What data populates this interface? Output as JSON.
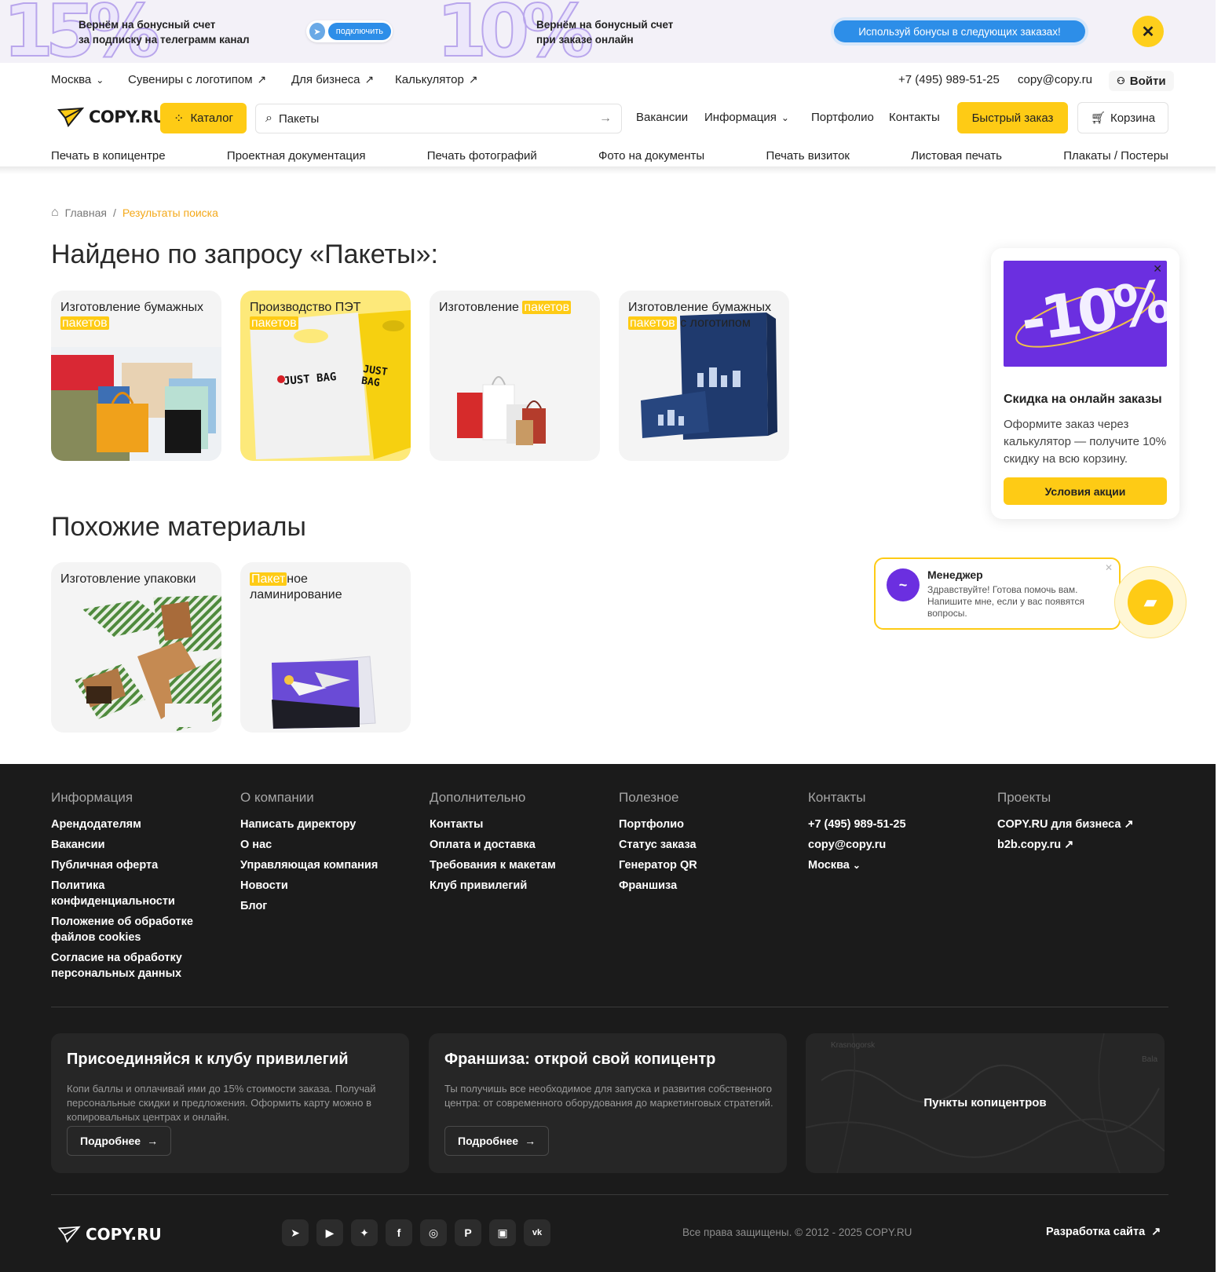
{
  "banner": {
    "pct15": "15%",
    "text1_line1": "Вернём на бонусный счет",
    "text1_line2": "за подписку на телеграмм канал",
    "telegram_button": "подключить",
    "pct10": "10%",
    "text2_line1": "Вернём на бонусный счет",
    "text2_line2": "при заказе онлайн",
    "cta": "Используй бонусы в следующих заказах!"
  },
  "topnav": {
    "city": "Москва",
    "links": [
      "Сувениры с логотипом",
      "Для бизнеса",
      "Калькулятор"
    ],
    "phone": "+7 (495) 989-51-25",
    "email": "copy@copy.ru",
    "login": "Войти"
  },
  "header": {
    "logo": "COPY.RU",
    "catalog": "Каталог",
    "search_value": "Пакеты",
    "links": [
      "Вакансии",
      "Информация",
      "Портфолио",
      "Контакты"
    ],
    "quick_order": "Быстрый заказ",
    "cart": "Корзина"
  },
  "categories": [
    "Печать в копицентре",
    "Проектная документация",
    "Печать фотографий",
    "Фото на документы",
    "Печать визиток",
    "Листовая печать",
    "Плакаты / Постеры"
  ],
  "breadcrumb": {
    "home": "Главная",
    "current": "Результаты поиска"
  },
  "results": {
    "heading": "Найдено по запросу «Пакеты»:",
    "cards": [
      {
        "pre": "Изготовление бумажных ",
        "hl": "пакетов",
        "post": ""
      },
      {
        "pre": "Производство ПЭТ ",
        "hl": "пакетов",
        "post": ""
      },
      {
        "pre": "Изготовление ",
        "hl": "пакетов",
        "post": ""
      },
      {
        "pre": "Изготовление бумажных ",
        "hl": "пакетов",
        "post": " с логотипом"
      }
    ],
    "bag_text": "JUST BAG"
  },
  "similar": {
    "heading": "Похожие материалы",
    "cards": [
      {
        "pre": "Изготовление упаковки",
        "hl": "",
        "post": ""
      },
      {
        "pre": "",
        "hl": "Пакет",
        "post": "ное ламинирование"
      }
    ]
  },
  "promo": {
    "image_text": "-10%",
    "title": "Скидка на онлайн заказы",
    "text": "Оформите заказ через калькулятор — получите 10% скидку на всю корзину.",
    "button": "Условия акции"
  },
  "chat": {
    "name": "Менеджер",
    "message": "Здравствуйте! Готова помочь вам. Напишите мне, если у вас появятся вопросы."
  },
  "footer": {
    "columns": [
      {
        "title": "Информация",
        "links": [
          "Арендодателям",
          "Вакансии",
          "Публичная оферта",
          "Политика конфиденциальности",
          "Положение об обработке файлов cookies",
          "Согласие на обработку персональных данных"
        ]
      },
      {
        "title": "О компании",
        "links": [
          "Написать директору",
          "О нас",
          "Управляющая компания",
          "Новости",
          "Блог"
        ]
      },
      {
        "title": "Дополнительно",
        "links": [
          "Контакты",
          "Оплата и доставка",
          "Требования к макетам",
          "Клуб привилегий"
        ]
      },
      {
        "title": "Полезное",
        "links": [
          "Портфолио",
          "Статус заказа",
          "Генератор QR",
          "Франшиза"
        ]
      },
      {
        "title": "Контакты",
        "links": [
          "+7 (495) 989-51-25",
          "copy@copy.ru",
          "Москва"
        ]
      },
      {
        "title": "Проекты",
        "links": [
          "COPY.RU для бизнеса",
          "b2b.copy.ru"
        ]
      }
    ],
    "club": {
      "title": "Присоединяйся к клубу привилегий",
      "text": "Копи баллы и оплачивай ими до 15% стоимости заказа. Получай персональные скидки и предложения. Оформить карту можно в копировальных центрах и онлайн.",
      "button": "Подробнее"
    },
    "franchise": {
      "title": "Франшиза: открой свой копицентр",
      "text": "Ты получишь все необходимое для запуска и развития собственного центра: от современного оборудования до маркетинговых стратегий.",
      "button": "Подробнее"
    },
    "map": {
      "label": "Пункты копицентров",
      "city1": "Krasnogorsk",
      "city2": "Bala"
    },
    "logo": "COPY.RU",
    "socials": [
      "telegram-icon",
      "youtube-icon",
      "star-icon",
      "facebook-icon",
      "instagram-icon",
      "pinterest-icon",
      "chat-icon",
      "vk-icon"
    ],
    "copyright": "Все права защищены. © 2012 - 2025 COPY.RU",
    "dev": "Разработка сайта"
  },
  "colors": {
    "accent": "#fecb15",
    "blue": "#2d8ee8",
    "footer_bg": "#1b1b1b",
    "purple": "#6b2fe0"
  }
}
